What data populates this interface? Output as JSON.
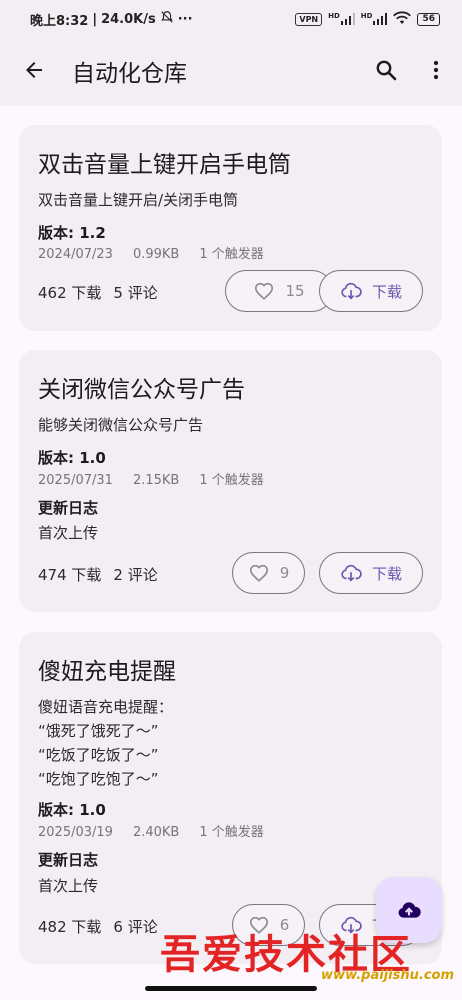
{
  "status_bar": {
    "time": "晚上8:32",
    "speed": "24.0K/s",
    "dots": "···",
    "vpn": "VPN",
    "hd1": "HD",
    "hd2": "HD",
    "battery": "56"
  },
  "app_bar": {
    "title": "自动化仓库",
    "back_icon": "arrow-left-icon",
    "search_icon": "search-icon",
    "more_icon": "more-vert-icon"
  },
  "colors": {
    "accent": "#6d55b0",
    "card_bg": "#f3eef4",
    "fab_bg": "#e8ddff",
    "watermark_red": "#e32424"
  },
  "scripts": [
    {
      "title": "双击音量上键开启手电筒",
      "description": "双击音量上键开启/关闭手电筒",
      "version": "版本: 1.2",
      "date": "2024/07/23",
      "size": "0.99KB",
      "triggers": "1 个触发器",
      "downloads": "462 下载",
      "comments": "5 评论",
      "likes": "15",
      "download_label": "下载"
    },
    {
      "title": "关闭微信公众号广告",
      "description": "能够关闭微信公众号广告",
      "version": "版本: 1.0",
      "date": "2025/07/31",
      "size": "2.15KB",
      "triggers": "1 个触发器",
      "changelog_title": "更新日志",
      "changelog": "首次上传",
      "downloads": "474 下载",
      "comments": "2 评论",
      "likes": "9",
      "download_label": "下载"
    },
    {
      "title": "傻妞充电提醒",
      "description": "傻妞语音充电提醒：\n“饿死了饿死了～”\n“吃饭了吃饭了～”\n“吃饱了吃饱了～”",
      "version": "版本: 1.0",
      "date": "2025/03/19",
      "size": "2.40KB",
      "triggers": "1 个触发器",
      "changelog_title": "更新日志",
      "changelog": "首次上传",
      "downloads": "482 下载",
      "comments": "6 评论",
      "likes": "6",
      "download_label": "下载"
    }
  ],
  "fab": {
    "icon": "cloud-upload-icon"
  },
  "watermark": {
    "text": "吾爱技术社区",
    "url": "www.paijishu.com"
  }
}
